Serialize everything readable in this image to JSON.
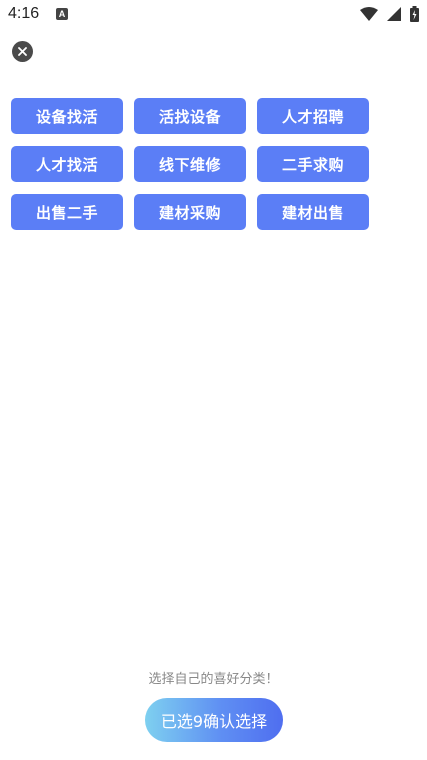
{
  "status_bar": {
    "time": "4:16",
    "app_icon_letter": "A",
    "icons": [
      "wifi-icon",
      "signal-icon",
      "battery-icon"
    ]
  },
  "close_icon": "close-icon",
  "categories": [
    "设备找活",
    "活找设备",
    "人才招聘",
    "人才找活",
    "线下维修",
    "二手求购",
    "出售二手",
    "建材采购",
    "建材出售"
  ],
  "footer": {
    "hint": "选择自己的喜好分类！",
    "confirm_label": "已选9确认选择"
  },
  "colors": {
    "category_button": "#5b7ef6",
    "confirm_gradient_start": "#7ed0f0",
    "confirm_gradient_end": "#4f6ef0",
    "hint_text": "#888888"
  }
}
